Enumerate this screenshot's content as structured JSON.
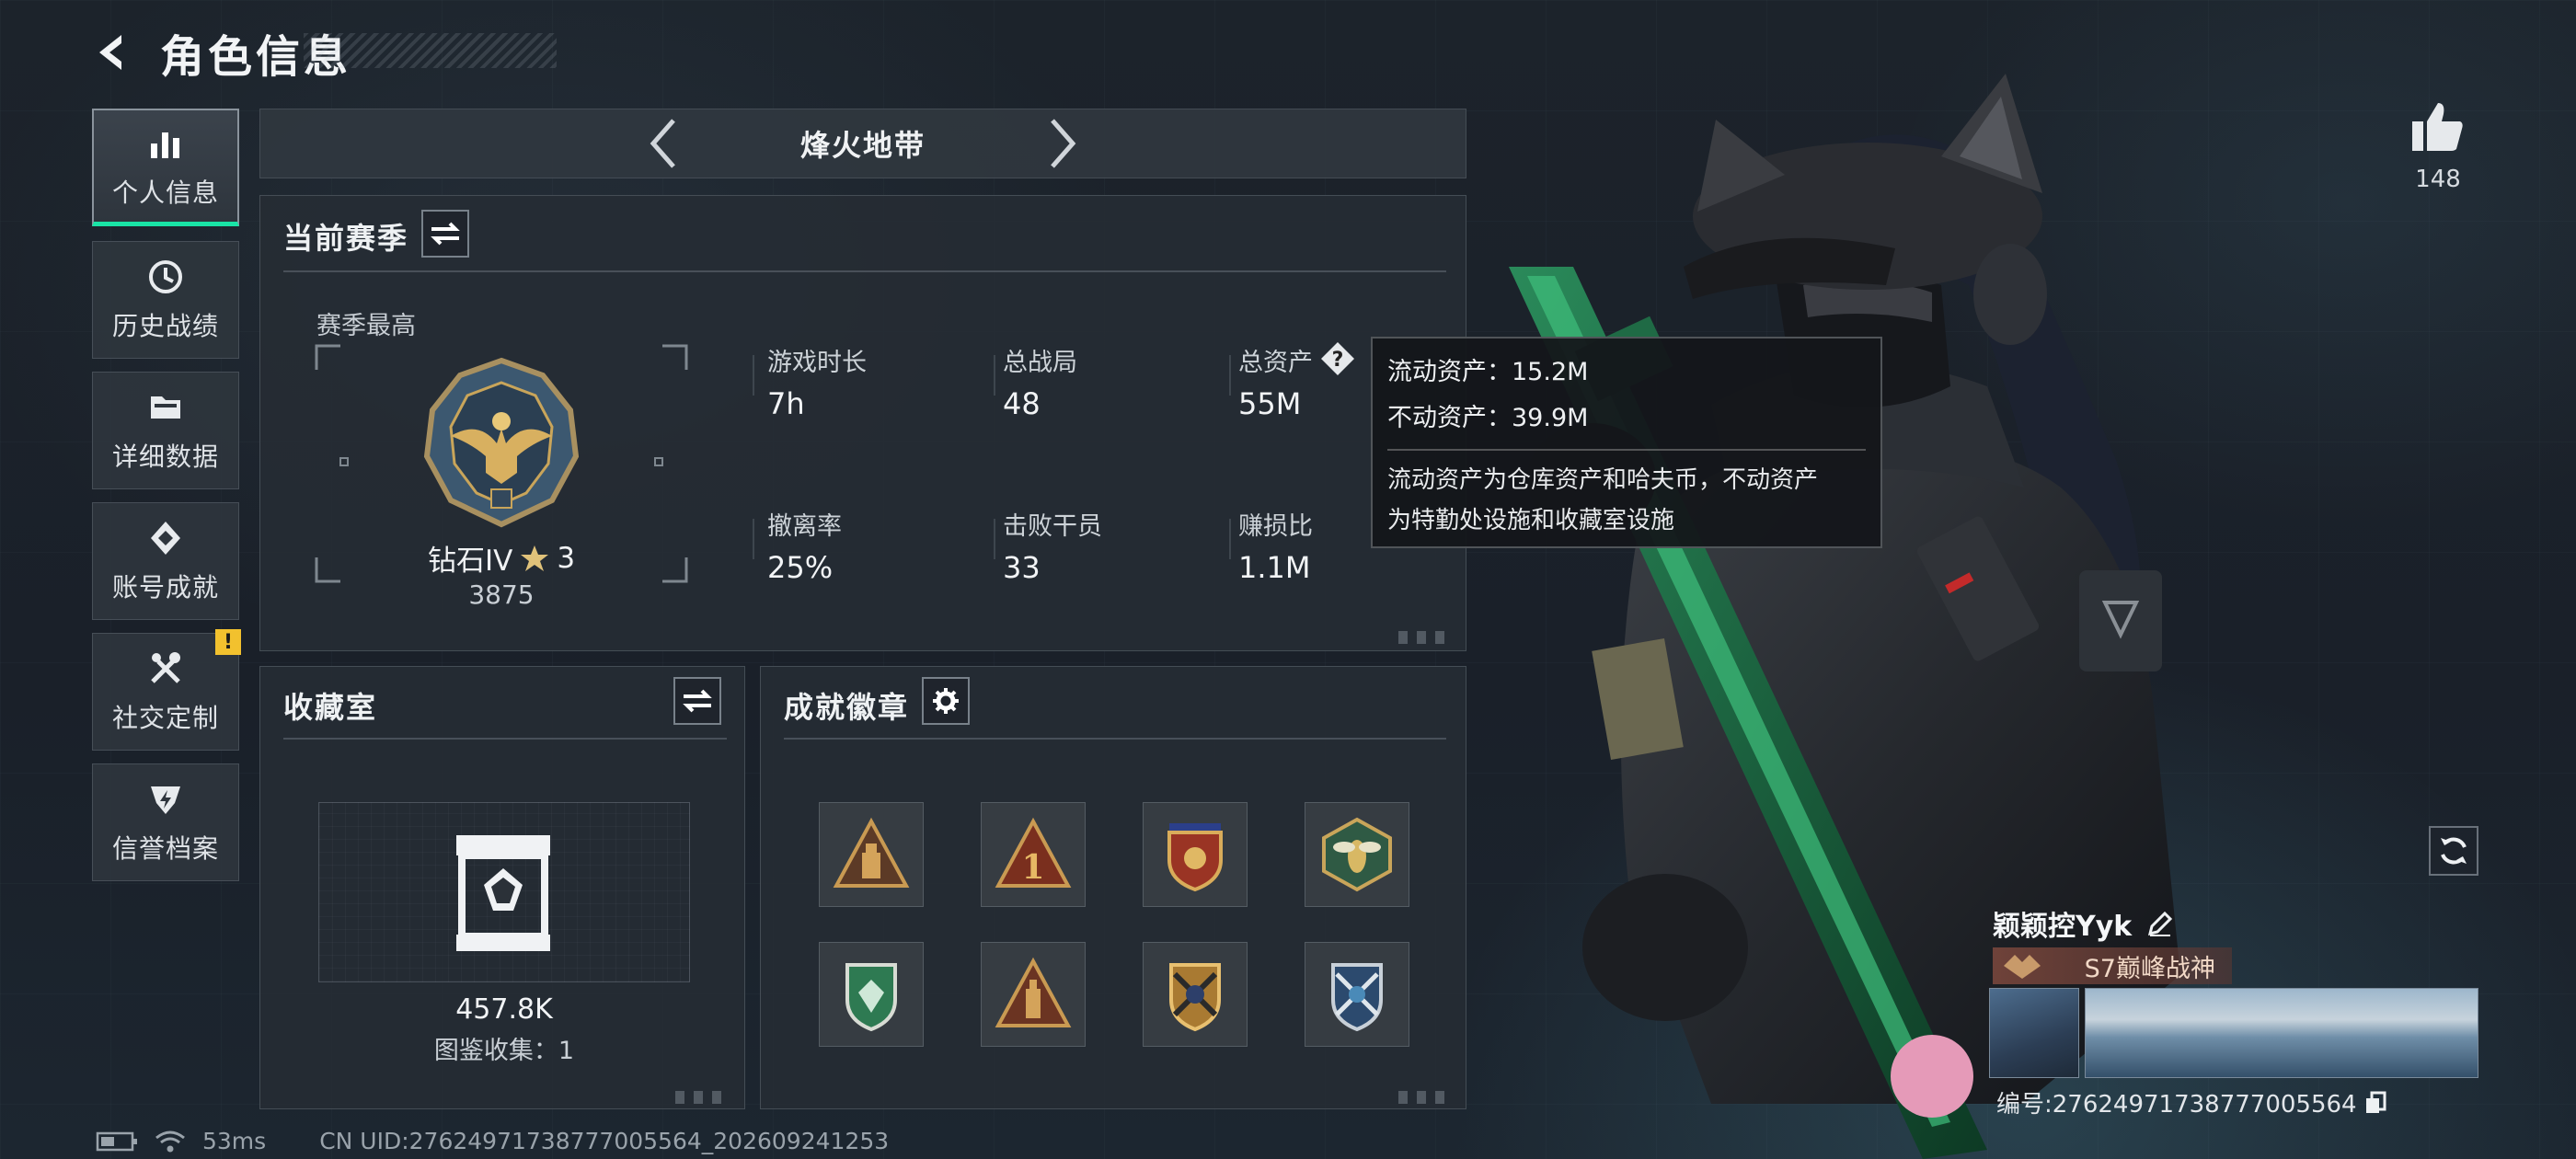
{
  "header": {
    "title": "角色信息"
  },
  "sidebar": {
    "items": [
      {
        "label": "个人信息",
        "icon": "bar-chart-icon",
        "active": true
      },
      {
        "label": "历史战绩",
        "icon": "history-icon"
      },
      {
        "label": "详细数据",
        "icon": "folder-icon"
      },
      {
        "label": "账号成就",
        "icon": "achievement-icon"
      },
      {
        "label": "社交定制",
        "icon": "tools-icon",
        "badge": "!"
      },
      {
        "label": "信誉档案",
        "icon": "shield-icon"
      }
    ]
  },
  "mode": {
    "name": "烽火地带"
  },
  "season": {
    "title": "当前赛季",
    "best_label": "赛季最高",
    "rank": "钻石IV",
    "rank_stars": "3",
    "rank_score": "3875",
    "stats": [
      {
        "label": "游戏时长",
        "value": "7h"
      },
      {
        "label": "总战局",
        "value": "48"
      },
      {
        "label": "总资产",
        "value": "55M"
      },
      {
        "label": "撤离率",
        "value": "25%"
      },
      {
        "label": "击败干员",
        "value": "33"
      },
      {
        "label": "赚损比",
        "value": "1.1M"
      }
    ]
  },
  "tooltip": {
    "liquid": "流动资产：15.2M",
    "fixed": "不动资产：39.9M",
    "desc_line1": "流动资产为仓库资产和哈夫币，不动资产",
    "desc_line2": "为特勤处设施和收藏室设施"
  },
  "collection": {
    "title": "收藏室",
    "value": "457.8K",
    "count_label": "图鉴收集：1"
  },
  "achievements": {
    "title": "成就徽章",
    "badges": [
      "badge-tower",
      "badge-number-one",
      "badge-shield-star",
      "badge-wasp",
      "badge-green-shield",
      "badge-tower-2",
      "badge-crossed-rifles",
      "badge-crossed-rifles-blue"
    ]
  },
  "profile": {
    "likes": "148",
    "name": "颖颖控Yyk",
    "title": "S7巅峰战神",
    "id_label": "编号:2762497173877700556​4"
  },
  "status": {
    "ping": "53ms",
    "uid": "CN UID:27624971738777005564_202609241253"
  },
  "colors": {
    "accent": "#19e4a6",
    "alert": "#f2c12e",
    "rank_gold": "#c9a55a"
  }
}
